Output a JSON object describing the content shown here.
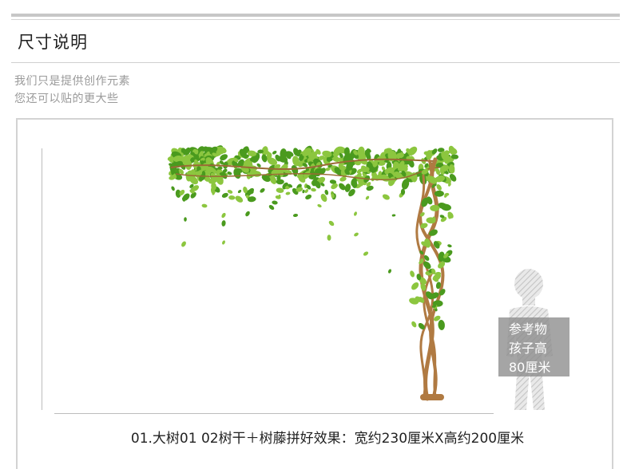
{
  "section": {
    "title": "尺寸说明",
    "notes": [
      "我们只是提供创作元素",
      "您还可以贴的更大些"
    ]
  },
  "reference": {
    "lines": [
      "参考物",
      "孩子高",
      "80厘米"
    ]
  },
  "caption": "01.大树01 02树干＋树藤拼好效果：宽约230厘米X高约200厘米",
  "colors": {
    "leaf_light": "#8cc63f",
    "leaf_dark": "#4a9a1e",
    "trunk": "#b07a42",
    "reference_box": "#8c8c8c"
  },
  "icons": {
    "tree": "tree-vine-illustration",
    "child": "child-silhouette-icon"
  }
}
